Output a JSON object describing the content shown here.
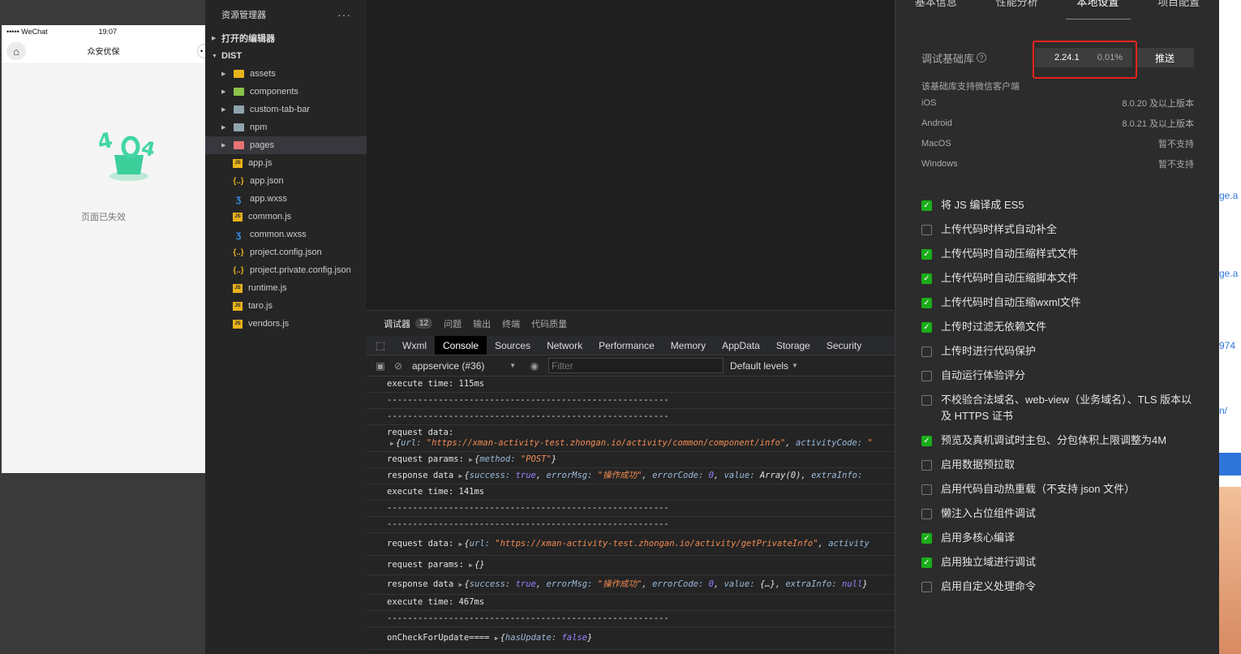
{
  "simulator": {
    "carrier": "••••• WeChat",
    "time": "19:07",
    "title": "众安优保",
    "home_icon": "home-icon",
    "empty_text": "页面已失效"
  },
  "explorer": {
    "title": "资源管理器",
    "more": "···",
    "open_editors": "打开的编辑器",
    "root": "DIST",
    "folders": [
      {
        "name": "assets",
        "color": "#e8b21a"
      },
      {
        "name": "components",
        "color": "#8bc34a"
      },
      {
        "name": "custom-tab-bar",
        "color": "#90a4ae"
      },
      {
        "name": "npm",
        "color": "#90a4ae"
      },
      {
        "name": "pages",
        "color": "#e57373"
      }
    ],
    "files": [
      {
        "name": "app.js",
        "type": "js"
      },
      {
        "name": "app.json",
        "type": "json"
      },
      {
        "name": "app.wxss",
        "type": "wxss"
      },
      {
        "name": "common.js",
        "type": "js"
      },
      {
        "name": "common.wxss",
        "type": "wxss"
      },
      {
        "name": "project.config.json",
        "type": "json"
      },
      {
        "name": "project.private.config.json",
        "type": "json"
      },
      {
        "name": "runtime.js",
        "type": "js"
      },
      {
        "name": "taro.js",
        "type": "js"
      },
      {
        "name": "vendors.js",
        "type": "js"
      }
    ]
  },
  "debugger": {
    "tabs": [
      "调试器",
      "问题",
      "输出",
      "终端",
      "代码质量"
    ],
    "badge": "12",
    "devtools_tabs": [
      "Wxml",
      "Console",
      "Sources",
      "Network",
      "Performance",
      "Memory",
      "AppData",
      "Storage",
      "Security"
    ],
    "context": "appservice (#36)",
    "filter_placeholder": "Filter",
    "levels": "Default levels"
  },
  "console": {
    "exec1": "execute time:  115ms",
    "sep": "-------------------------------------------------------",
    "req_data_label": "request data:",
    "url1": "\"https://xman-activity-test.zhongan.io/activity/common/component/info\"",
    "activity_code": "activityCode:",
    "params_label": "request params:",
    "method_post": "\"POST\"",
    "resp_label": "response data",
    "success_true": "true",
    "error_msg": "\"操作成功\"",
    "error_code": "0",
    "array0": "Array(0)",
    "extra_info": "extraInfo:",
    "exec2": "execute time:  141ms",
    "url2": "\"https://xman-activity-test.zhongan.io/activity/getPrivateInfo\"",
    "activity": "activity",
    "empty_obj": "{}",
    "value_obj": "{…}",
    "null_val": "null",
    "exec3": "execute time:  467ms",
    "check_update": "onCheckForUpdate====",
    "has_update_false": "false"
  },
  "settings": {
    "tabs": [
      "基本信息",
      "性能分析",
      "本地设置",
      "项目配置"
    ],
    "lib_label": "调试基础库",
    "lib_version": "2.24.1",
    "lib_pct": "0.01%",
    "push_label": "推送",
    "support_head": "该基础库支持微信客户端",
    "support": [
      {
        "os": "iOS",
        "ver": "8.0.20 及以上版本"
      },
      {
        "os": "Android",
        "ver": "8.0.21 及以上版本"
      },
      {
        "os": "MacOS",
        "ver": "暂不支持"
      },
      {
        "os": "Windows",
        "ver": "暂不支持"
      }
    ],
    "options": [
      {
        "label": "将 JS 编译成 ES5",
        "checked": true
      },
      {
        "label": "上传代码时样式自动补全",
        "checked": false
      },
      {
        "label": "上传代码时自动压缩样式文件",
        "checked": true
      },
      {
        "label": "上传代码时自动压缩脚本文件",
        "checked": true
      },
      {
        "label": "上传代码时自动压缩wxml文件",
        "checked": true
      },
      {
        "label": "上传时过滤无依赖文件",
        "checked": true
      },
      {
        "label": "上传时进行代码保护",
        "checked": false
      },
      {
        "label": "自动运行体验评分",
        "checked": false
      },
      {
        "label": "不校验合法域名、web-view（业务域名）、TLS 版本以及 HTTPS 证书",
        "checked": false
      },
      {
        "label": "预览及真机调试时主包、分包体积上限调整为4M",
        "checked": true
      },
      {
        "label": "启用数据预拉取",
        "checked": false
      },
      {
        "label": "启用代码自动热重载（不支持 json 文件）",
        "checked": false
      },
      {
        "label": "懒注入占位组件调试",
        "checked": false
      },
      {
        "label": "启用多核心编译",
        "checked": true
      },
      {
        "label": "启用独立域进行调试",
        "checked": true
      },
      {
        "label": "启用自定义处理命令",
        "checked": false
      }
    ]
  },
  "far": {
    "t1": "ge.a",
    "t2": "ge.a",
    "t3": "974",
    "t4": "n/"
  },
  "colors": {
    "checkbox_on": "#1aad19",
    "highlight": "#e8241b",
    "link": "#2f74d9"
  }
}
